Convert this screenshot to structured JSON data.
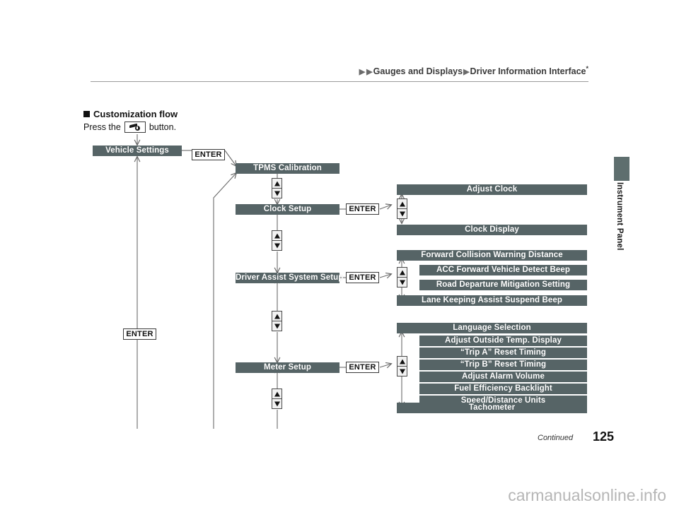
{
  "header": {
    "breadcrumb": [
      "Gauges and Displays",
      "Driver Information Interface"
    ],
    "breadcrumb_arrow": "▶",
    "footnote_marker": "*"
  },
  "side_tab": {
    "label": "Instrument Panel",
    "color": "#5e6e6e"
  },
  "section": {
    "heading": "Customization flow",
    "instruction_prefix": "Press the",
    "instruction_suffix": "button.",
    "button_icon": "customization-settings-icon"
  },
  "labels": {
    "enter": "ENTER",
    "up_arrow_icon": "triangle-up-icon",
    "down_arrow_icon": "triangle-down-icon"
  },
  "colors": {
    "node_fill": "#566466",
    "node_text": "#ffffff",
    "line": "#6b6b6b",
    "rule": "#9a9a9a"
  },
  "flow": {
    "root": {
      "label": "Vehicle Settings"
    },
    "level1": [
      {
        "label": "TPMS Calibration",
        "has_enter": false
      },
      {
        "label": "Clock Setup",
        "has_enter": true
      },
      {
        "label": "Driver Assist System Setup",
        "has_enter": true
      },
      {
        "label": "Meter Setup",
        "has_enter": true
      }
    ],
    "clock_group": [
      {
        "label": "Adjust Clock",
        "wide": true
      },
      {
        "label": "Clock Display",
        "wide": true
      }
    ],
    "driver_assist_group": [
      {
        "label": "Forward Collision Warning Distance",
        "wide": true
      },
      {
        "label": "ACC Forward Vehicle Detect Beep",
        "wide": false
      },
      {
        "label": "Road Departure Mitigation Setting",
        "wide": false
      },
      {
        "label": "Lane Keeping Assist Suspend Beep",
        "wide": true
      }
    ],
    "meter_group": [
      {
        "label": "Language Selection",
        "wide": true
      },
      {
        "label": "Adjust Outside Temp. Display",
        "wide": false
      },
      {
        "label": "“Trip A” Reset Timing",
        "wide": false
      },
      {
        "label": "“Trip B” Reset Timing",
        "wide": false
      },
      {
        "label": "Adjust Alarm Volume",
        "wide": false
      },
      {
        "label": "Fuel Efficiency Backlight",
        "wide": false
      },
      {
        "label": "Speed/Distance Units",
        "wide": false
      },
      {
        "label": "Tachometer",
        "wide": true
      }
    ]
  },
  "footer": {
    "continued": "Continued",
    "page_number": "125"
  },
  "watermark": "carmanualsonline.info"
}
